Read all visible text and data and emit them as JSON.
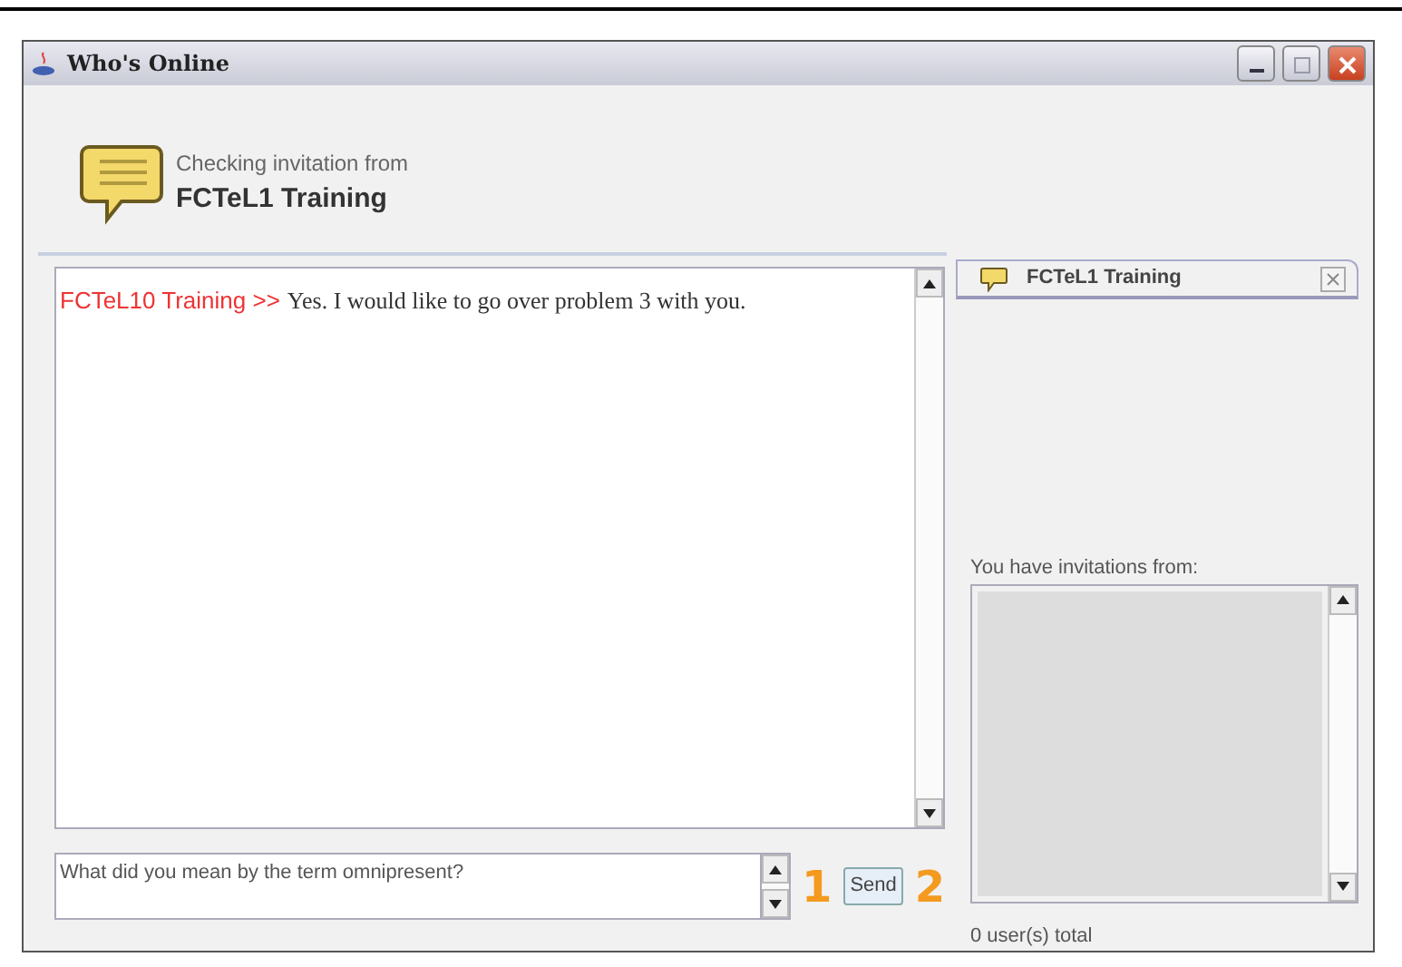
{
  "window": {
    "title": "Who's Online"
  },
  "header": {
    "caption": "Checking invitation from",
    "name": "FCTeL1 Training"
  },
  "chat": {
    "messages": [
      {
        "sender": "FCTeL10 Training >>",
        "text": "Yes. I would like to go over problem 3 with you."
      }
    ]
  },
  "compose": {
    "value": "What did you mean by the term omnipresent?",
    "callout": "1"
  },
  "send_button": {
    "label": "Send",
    "callout": "2"
  },
  "tabs": [
    {
      "label": "FCTeL1 Training",
      "selected": true
    }
  ],
  "invitations": {
    "label": "You have invitations from:",
    "total": "0 user(s) total"
  }
}
